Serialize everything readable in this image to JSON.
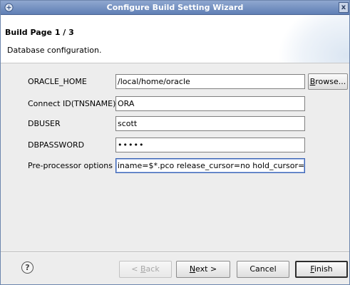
{
  "window": {
    "title": "Configure Build Setting Wizard",
    "close_glyph": "x"
  },
  "header": {
    "page_title": "Build Page 1 / 3",
    "description": "Database configuration."
  },
  "form": {
    "oracle_home": {
      "label": "ORACLE_HOME",
      "value": "/local/home/oracle"
    },
    "connect_id": {
      "label": "Connect ID(TNSNAME)",
      "value": "ORA"
    },
    "dbuser": {
      "label": "DBUSER",
      "value": "scott"
    },
    "dbpassword": {
      "label": "DBPASSWORD",
      "value": "•••••"
    },
    "preprocessor": {
      "label": "Pre-processor options",
      "value": "iname=$*.pco release_cursor=no hold_cursor="
    }
  },
  "buttons": {
    "browse": {
      "mnemonic": "B",
      "rest": "rowse..."
    },
    "back": {
      "prefix": "< ",
      "mnemonic": "B",
      "rest": "ack"
    },
    "next": {
      "mnemonic": "N",
      "rest": "ext >"
    },
    "cancel": {
      "label": "Cancel"
    },
    "finish": {
      "mnemonic": "F",
      "rest": "inish"
    },
    "help": "?"
  },
  "colors": {
    "titlebar": "#6e8cbf",
    "focus_border": "#3a62b4"
  }
}
